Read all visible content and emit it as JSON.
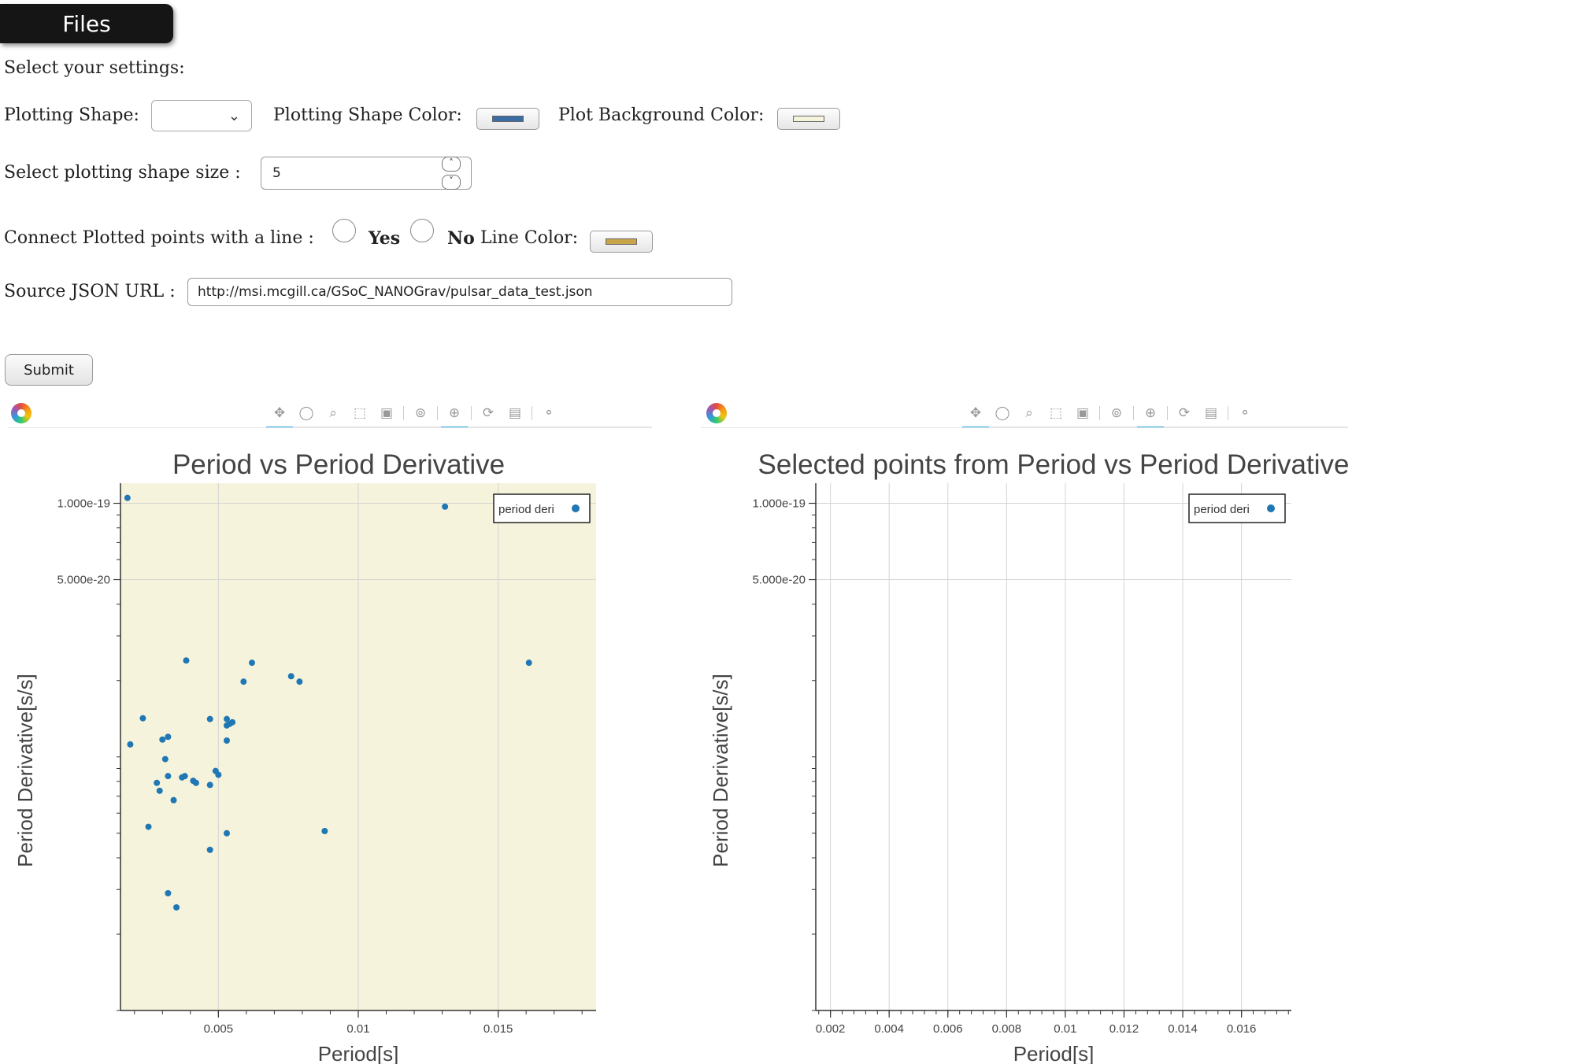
{
  "files_tab": {
    "label": "Files"
  },
  "form": {
    "select_settings": "Select your settings:",
    "plotting_shape_label": "Plotting Shape:",
    "plotting_shape_value": "",
    "shape_color_label": "Plotting Shape Color:",
    "shape_color": "#3a6ea5",
    "bg_color_label": "Plot Background Color:",
    "bg_color": "#f5f3dc",
    "shape_size_label": "Select plotting shape size :",
    "shape_size_value": "5",
    "connect_label": "Connect Plotted points with a line :",
    "yes_label": "Yes",
    "no_label": "No",
    "line_color_label": "Line Color:",
    "line_color": "#c9a54a",
    "source_label": "Source JSON URL :",
    "source_url": "http://msi.mcgill.ca/GSoC_NANOGrav/pulsar_data_test.json",
    "submit_label": "Submit"
  },
  "toolbar_icons": [
    "pan-icon",
    "lasso-select-icon",
    "wheel-zoom-icon",
    "box-select-icon",
    "box-zoom-icon",
    "zoom-tool-icon",
    "crosshair-icon",
    "reset-icon",
    "save-icon",
    "hover-icon"
  ],
  "chart_data": [
    {
      "type": "scatter",
      "title": "Period vs Period Derivative",
      "xlabel": "Period[s]",
      "ylabel": "Period Derivative[s/s]",
      "xlim": [
        0.0015,
        0.0185
      ],
      "ylim": [
        1e-21,
        1.2e-19
      ],
      "yscale": "log",
      "xticks": [
        0.005,
        0.01,
        0.015
      ],
      "xtick_labels": [
        "0.005",
        "0.01",
        "0.015"
      ],
      "yticks": [
        1e-19,
        5e-20
      ],
      "ytick_labels": [
        "1.000e-19",
        "5.000e-20"
      ],
      "background": "#f5f3dc",
      "point_color": "#1f77b4",
      "grid": true,
      "legend": {
        "label": "period deri",
        "position": "top-right"
      },
      "series": [
        {
          "x": [
            0.00175,
            0.0131,
            0.00385,
            0.0062,
            0.0161,
            0.0059,
            0.0076,
            0.0079,
            0.0023,
            0.0047,
            0.0053,
            0.0054,
            0.0055,
            0.0053,
            0.0032,
            0.003,
            0.0053,
            0.00185,
            0.0031,
            0.0049,
            0.0032,
            0.0037,
            0.0038,
            0.005,
            0.0041,
            0.0042,
            0.0047,
            0.0028,
            0.0029,
            0.0034,
            0.0025,
            0.0088,
            0.0053,
            0.0047,
            0.0032,
            0.0035
          ],
          "y": [
            1.05e-19,
            9.7e-20,
            2.4e-20,
            2.35e-20,
            2.35e-20,
            1.98e-20,
            2.08e-20,
            1.98e-20,
            1.42e-20,
            1.41e-20,
            1.41e-20,
            1.35e-20,
            1.37e-20,
            1.33e-20,
            1.2e-20,
            1.17e-20,
            1.16e-20,
            1.12e-20,
            9.8e-21,
            8.8e-21,
            8.4e-21,
            8.3e-21,
            8.4e-21,
            8.5e-21,
            8.05e-21,
            7.9e-21,
            7.75e-21,
            7.9e-21,
            7.35e-21,
            6.75e-21,
            5.3e-21,
            5.1e-21,
            5e-21,
            4.3e-21,
            2.9e-21,
            2.55e-21
          ]
        }
      ]
    },
    {
      "type": "scatter",
      "title": "Selected points from Period vs Period Derivative",
      "xlabel": "Period[s]",
      "ylabel": "Period Derivative[s/s]",
      "xlim": [
        0.0015,
        0.0177
      ],
      "ylim": [
        1e-21,
        1.2e-19
      ],
      "yscale": "log",
      "xticks": [
        0.002,
        0.004,
        0.006,
        0.008,
        0.01,
        0.012,
        0.014,
        0.016
      ],
      "xtick_labels": [
        "0.002",
        "0.004",
        "0.006",
        "0.008",
        "0.01",
        "0.012",
        "0.014",
        "0.016"
      ],
      "yticks": [
        1e-19,
        5e-20
      ],
      "ytick_labels": [
        "1.000e-19",
        "5.000e-20"
      ],
      "background": "#ffffff",
      "point_color": "#1f77b4",
      "grid": true,
      "legend": {
        "label": "period deri",
        "position": "top-right"
      },
      "series": [
        {
          "x": [],
          "y": []
        }
      ]
    }
  ]
}
